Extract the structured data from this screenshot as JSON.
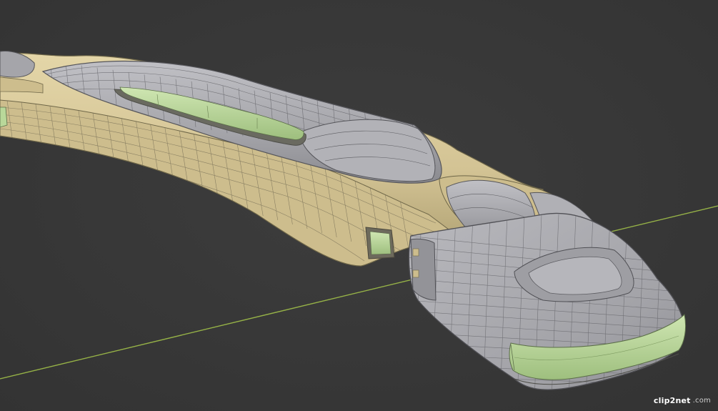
{
  "viewport": {
    "background": "#3a3a3a",
    "axis_color": "#a7c84a"
  },
  "model": {
    "hull_tan": "#d6c79b",
    "hull_grey": "#a8a8ad",
    "accent_green": "#b9d89a",
    "wire_color": "#5a5850"
  },
  "watermark": {
    "brand": "clip2net",
    "tld": ".com"
  }
}
